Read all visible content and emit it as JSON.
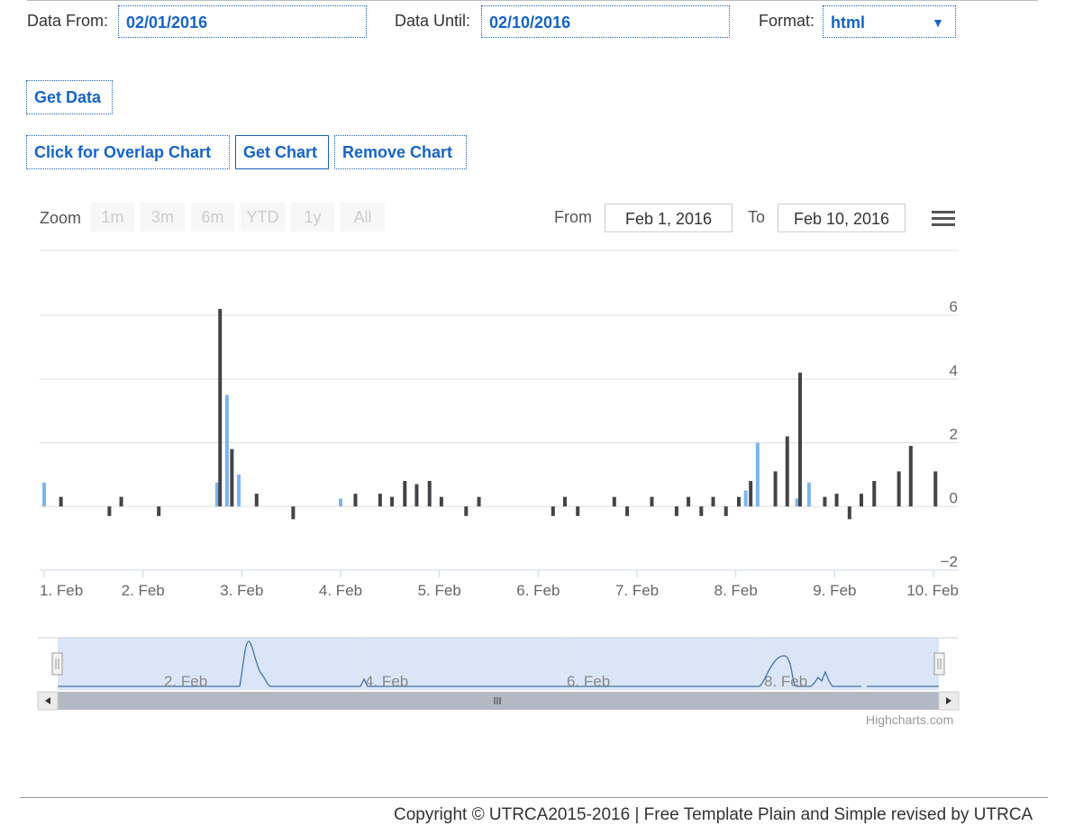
{
  "form": {
    "from_label": "Data From:",
    "from_value": "02/01/2016",
    "until_label": "Data Until:",
    "until_value": "02/10/2016",
    "format_label": "Format:",
    "format_value": "html",
    "get_data": "Get Data",
    "overlap_chart": "Click for Overlap Chart",
    "get_chart": "Get Chart",
    "remove_chart": "Remove Chart"
  },
  "range_selector": {
    "zoom_label": "Zoom",
    "buttons": [
      "1m",
      "3m",
      "6m",
      "YTD",
      "1y",
      "All"
    ],
    "from_label": "From",
    "from_value": "Feb 1, 2016",
    "to_label": "To",
    "to_value": "Feb 10, 2016"
  },
  "navigator": {
    "labels": [
      "2. Feb",
      "4. Feb",
      "6. Feb",
      "8. Feb"
    ]
  },
  "credits": "Highcharts.com",
  "footer": "Copyright © UTRCA2015-2016 | Free Template Plain and Simple revised by UTRCA",
  "colors": {
    "dark_series": "#434348",
    "light_series": "#7cb5ec",
    "link": "#1464c8",
    "navigator_fill": "#dae6f7"
  },
  "chart_data": {
    "type": "bar",
    "x_tick_labels": [
      "1. Feb",
      "2. Feb",
      "3. Feb",
      "4. Feb",
      "5. Feb",
      "6. Feb",
      "7. Feb",
      "8. Feb",
      "9. Feb",
      "10. Feb"
    ],
    "y_tick_labels": [
      "-2",
      "0",
      "2",
      "4",
      "6"
    ],
    "ylim": [
      -2,
      6
    ],
    "xlim": [
      1.0,
      10.2
    ],
    "grid": true,
    "legend": "none",
    "series": [
      {
        "color": "#7cb5ec",
        "points": [
          [
            1.0,
            0.75
          ],
          [
            2.75,
            0.75
          ],
          [
            2.85,
            3.5
          ],
          [
            2.97,
            1.0
          ],
          [
            4.0,
            0.25
          ],
          [
            8.1,
            0.5
          ],
          [
            8.22,
            2.0
          ],
          [
            8.62,
            0.25
          ],
          [
            8.74,
            0.75
          ]
        ]
      },
      {
        "color": "#434348",
        "points": [
          [
            1.17,
            0.3
          ],
          [
            1.66,
            -0.3
          ],
          [
            1.78,
            0.3
          ],
          [
            2.16,
            -0.3
          ],
          [
            2.78,
            6.2
          ],
          [
            2.9,
            1.8
          ],
          [
            3.15,
            0.4
          ],
          [
            3.52,
            -0.4
          ],
          [
            4.15,
            0.4
          ],
          [
            4.4,
            0.4
          ],
          [
            4.52,
            0.3
          ],
          [
            4.65,
            0.8
          ],
          [
            4.77,
            0.7
          ],
          [
            4.9,
            0.8
          ],
          [
            5.02,
            0.3
          ],
          [
            5.27,
            -0.3
          ],
          [
            5.4,
            0.3
          ],
          [
            6.15,
            -0.3
          ],
          [
            6.27,
            0.3
          ],
          [
            6.4,
            -0.3
          ],
          [
            6.77,
            0.3
          ],
          [
            6.9,
            -0.3
          ],
          [
            7.15,
            0.3
          ],
          [
            7.4,
            -0.3
          ],
          [
            7.52,
            0.3
          ],
          [
            7.65,
            -0.3
          ],
          [
            7.77,
            0.3
          ],
          [
            7.9,
            -0.3
          ],
          [
            8.03,
            0.3
          ],
          [
            8.15,
            0.8
          ],
          [
            8.4,
            1.1
          ],
          [
            8.52,
            2.2
          ],
          [
            8.65,
            4.2
          ],
          [
            8.9,
            0.3
          ],
          [
            9.02,
            0.4
          ],
          [
            9.15,
            -0.4
          ],
          [
            9.27,
            0.4
          ],
          [
            9.4,
            0.8
          ],
          [
            9.65,
            1.1
          ],
          [
            9.77,
            1.9
          ],
          [
            10.02,
            1.1
          ]
        ]
      }
    ]
  }
}
